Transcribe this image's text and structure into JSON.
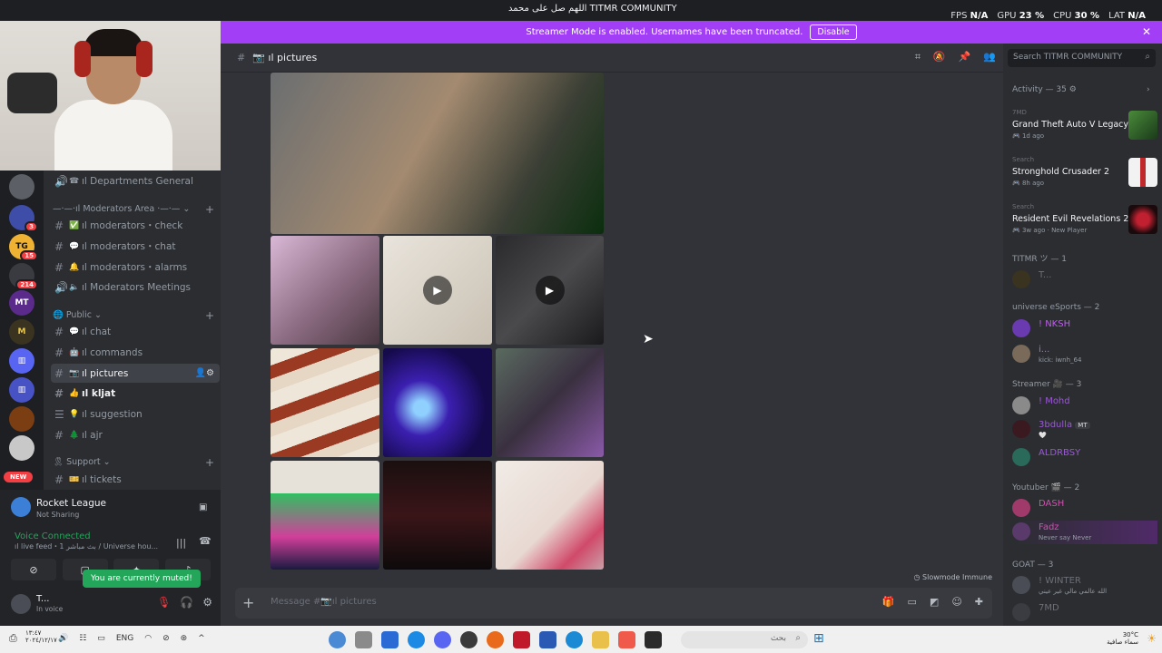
{
  "window": {
    "title": "TITMR COMMUNITY",
    "overlay_text": "اللهم صل على محمد",
    "stats": {
      "fps_label": "FPS",
      "fps": "N/A",
      "gpu_label": "GPU",
      "gpu": "23 %",
      "cpu_label": "CPU",
      "cpu": "30 %",
      "lat_label": "LAT",
      "lat": "N/A"
    }
  },
  "banner": {
    "text": "Streamer Mode is enabled. Usernames have been truncated.",
    "button": "Disable",
    "bg": "#a23ff6"
  },
  "servers": {
    "badges": [
      "3",
      "15",
      "214"
    ],
    "new_label": "NEW",
    "labels": {
      "tg": "TG",
      "mt": "MT"
    }
  },
  "channels": {
    "items": [
      {
        "name": "ıl Departments General",
        "type": "voice"
      },
      {
        "category": "—·—·ıl Moderators Area ·—·—"
      },
      {
        "name": "ıl moderators・check",
        "emoji": "✅"
      },
      {
        "name": "ıl moderators・chat",
        "emoji": "💬"
      },
      {
        "name": "ıl moderators・alarms",
        "emoji": "🔔"
      },
      {
        "name": "ıl Moderators Meetings",
        "type": "voice"
      },
      {
        "category": "Public"
      },
      {
        "name": "ıl chat",
        "emoji": "💬"
      },
      {
        "name": "ıl commands",
        "emoji": "🤖"
      },
      {
        "name": "ıl pictures",
        "emoji": "📷",
        "active": true
      },
      {
        "name": "ıl kljat",
        "emoji": "👍",
        "unread": true
      },
      {
        "name": "ıl suggestion",
        "emoji": "💡"
      },
      {
        "name": "ıl ajr",
        "emoji": "🌲"
      },
      {
        "category": "Support"
      },
      {
        "name": "ıl tickets",
        "emoji": "🎫"
      }
    ]
  },
  "user_panel": {
    "activity_title": "Rocket League",
    "activity_status": "Not Sharing",
    "voice_title": "Voice Connected",
    "voice_channel": "ıl live feed・1 بث مباشر / Universe hou...",
    "muted_tip": "You are currently muted!",
    "username": "T...",
    "user_status": "In voice"
  },
  "main": {
    "channel_title": "ıl pictures",
    "composer_placeholder": "Message #📷ıl pictures",
    "slowmode": "Slowmode Immune"
  },
  "right": {
    "search_placeholder": "Search TITMR COMMUNITY",
    "activity_header": "Activity — 35",
    "games": [
      {
        "user": "7MD",
        "name": "Grand Theft Auto V Legacy",
        "time": "1d ago"
      },
      {
        "user": "Search",
        "name": "Stronghold Crusader 2",
        "time": "8h ago"
      },
      {
        "user": "Search",
        "name": "Resident Evil Revelations 2...",
        "time": "3w ago",
        "extra": "New Player"
      }
    ],
    "groups": [
      {
        "header": "TITMR ツ — 1",
        "members": [
          {
            "name": "T...",
            "color": "#6d6f78"
          }
        ]
      },
      {
        "header": "universe eSports — 2",
        "members": [
          {
            "name": "! NKSH",
            "color": "#c25cf2"
          },
          {
            "name": "i...",
            "color": "#c25cf2",
            "status": "kick: iwnh_64"
          }
        ]
      },
      {
        "header": "Streamer 🎥 — 3",
        "members": [
          {
            "name": "! Mohd",
            "color": "#9b59d6"
          },
          {
            "name": "3bdulla",
            "color": "#9b59d6",
            "status": "🤍",
            "tag": "MT"
          },
          {
            "name": "ALDRBSY",
            "color": "#9b59d6"
          }
        ]
      },
      {
        "header": "Youtuber 🎬 — 2",
        "members": [
          {
            "name": "DASH",
            "color": "#d24fb0"
          },
          {
            "name": "Fadz",
            "color": "#d24fb0",
            "status": "Never say Never"
          }
        ]
      },
      {
        "header": "GOAT — 3",
        "members": [
          {
            "name": "! WINTER",
            "color": "#6d6f78",
            "status": "الله عالمي مالي غير عيني"
          },
          {
            "name": "7MD",
            "color": "#6d6f78"
          }
        ]
      }
    ]
  },
  "taskbar": {
    "time": "١٣:٤٧",
    "date": "٢٠٢٤/١٢/١٧",
    "lang": "ENG",
    "search_text": "بحث",
    "weather_temp": "30°C",
    "weather_desc": "سماء صافية"
  }
}
